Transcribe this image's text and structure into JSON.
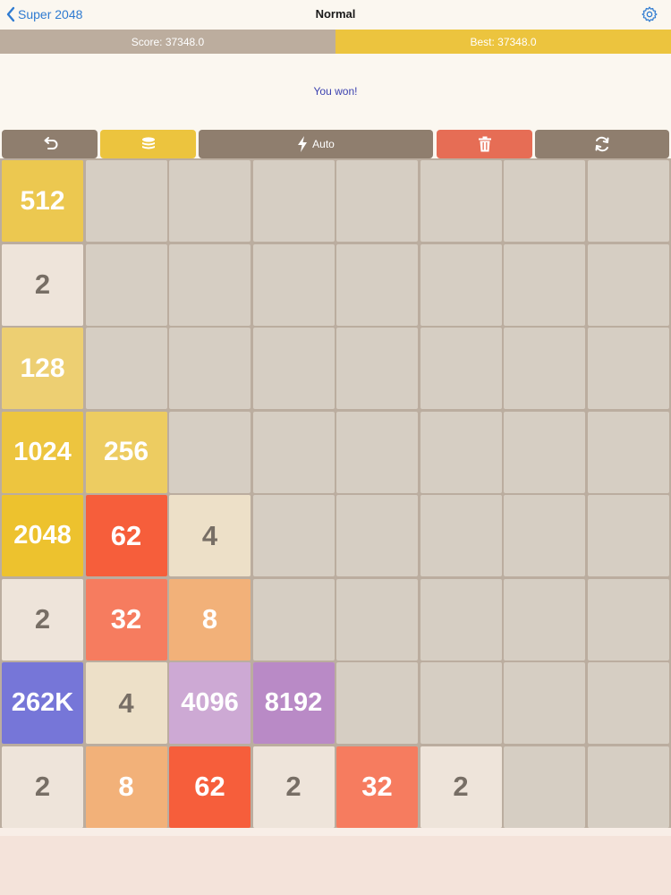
{
  "nav": {
    "back_label": "Super 2048",
    "title": "Normal",
    "settings_icon": "gear-icon",
    "back_icon": "chevron-left-icon"
  },
  "scores": {
    "score_label": "Score: 37348.0",
    "best_label": "Best: 37348.0"
  },
  "message": "You won!",
  "toolbar": {
    "undo_icon": "undo-icon",
    "coins_icon": "coins-icon",
    "auto_icon": "lightning-icon",
    "auto_label": "Auto",
    "delete_icon": "trash-icon",
    "restart_icon": "refresh-icon"
  },
  "colors": {
    "board": "#bbad9f",
    "empty_cell": "#d6cec3",
    "accent_blue": "#2f7bd1",
    "best_bg": "#ecc43e",
    "score_bg": "#bcad9e",
    "message_color": "#3c42b0"
  },
  "board": {
    "size": 8,
    "rows": [
      [
        {
          "label": "512",
          "bg": "#ecc850",
          "fg": "#ffffff"
        },
        null,
        null,
        null,
        null,
        null,
        null,
        null
      ],
      [
        {
          "label": "2",
          "bg": "#eee4da",
          "fg": "#776e65"
        },
        null,
        null,
        null,
        null,
        null,
        null,
        null
      ],
      [
        {
          "label": "128",
          "bg": "#edcf72",
          "fg": "#ffffff"
        },
        null,
        null,
        null,
        null,
        null,
        null,
        null
      ],
      [
        {
          "label": "1024",
          "bg": "#edc53f",
          "fg": "#ffffff"
        },
        {
          "label": "256",
          "bg": "#edcc61",
          "fg": "#ffffff"
        },
        null,
        null,
        null,
        null,
        null,
        null
      ],
      [
        {
          "label": "2048",
          "bg": "#edc22e",
          "fg": "#ffffff"
        },
        {
          "label": "62",
          "bg": "#f65e3b",
          "fg": "#ffffff"
        },
        {
          "label": "4",
          "bg": "#ede0c8",
          "fg": "#776e65"
        },
        null,
        null,
        null,
        null,
        null
      ],
      [
        {
          "label": "2",
          "bg": "#eee4da",
          "fg": "#776e65"
        },
        {
          "label": "32",
          "bg": "#f67c5f",
          "fg": "#ffffff"
        },
        {
          "label": "8",
          "bg": "#f2b179",
          "fg": "#ffffff"
        },
        null,
        null,
        null,
        null,
        null
      ],
      [
        {
          "label": "262K",
          "bg": "#7676d8",
          "fg": "#ffffff"
        },
        {
          "label": "4",
          "bg": "#ede0c8",
          "fg": "#776e65"
        },
        {
          "label": "4096",
          "bg": "#cda9d4",
          "fg": "#ffffff"
        },
        {
          "label": "8192",
          "bg": "#b98ac6",
          "fg": "#ffffff"
        },
        null,
        null,
        null,
        null
      ],
      [
        {
          "label": "2",
          "bg": "#eee4da",
          "fg": "#776e65"
        },
        {
          "label": "8",
          "bg": "#f2b179",
          "fg": "#ffffff"
        },
        {
          "label": "62",
          "bg": "#f65e3b",
          "fg": "#ffffff"
        },
        {
          "label": "2",
          "bg": "#eee4da",
          "fg": "#776e65"
        },
        {
          "label": "32",
          "bg": "#f67c5f",
          "fg": "#ffffff"
        },
        {
          "label": "2",
          "bg": "#eee4da",
          "fg": "#776e65"
        },
        null,
        null
      ]
    ]
  }
}
